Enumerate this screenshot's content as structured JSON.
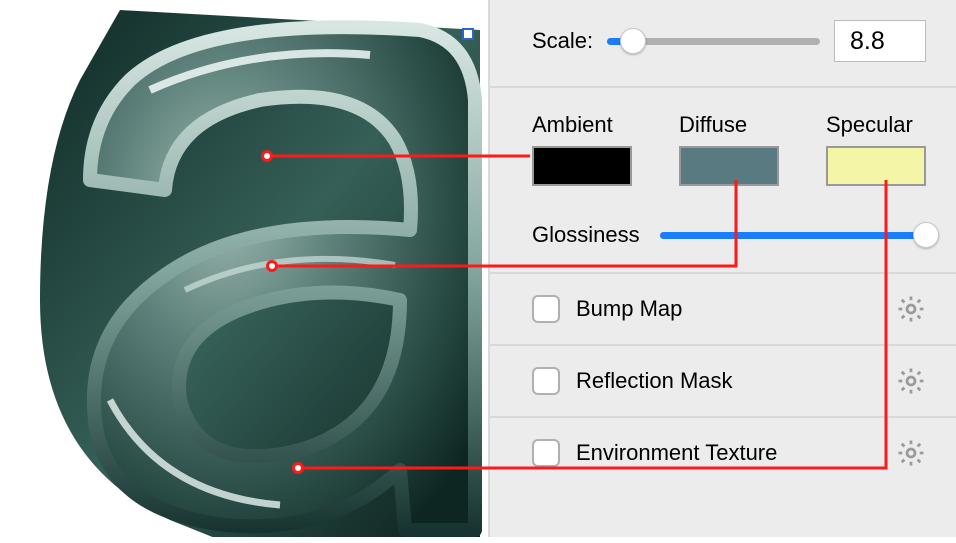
{
  "scale": {
    "label": "Scale:",
    "value": "8.8",
    "fill_percent": 12
  },
  "swatches": {
    "ambient": {
      "label": "Ambient",
      "color": "#000000"
    },
    "diffuse": {
      "label": "Diffuse",
      "color": "#5a7a82"
    },
    "specular": {
      "label": "Specular",
      "color": "#f4f5a7"
    }
  },
  "glossiness": {
    "label": "Glossiness",
    "fill_percent": 100
  },
  "checkboxes": {
    "bump": {
      "label": "Bump Map",
      "checked": false
    },
    "reflection": {
      "label": "Reflection Mask",
      "checked": false
    },
    "environment": {
      "label": "Environment Texture",
      "checked": false
    }
  }
}
